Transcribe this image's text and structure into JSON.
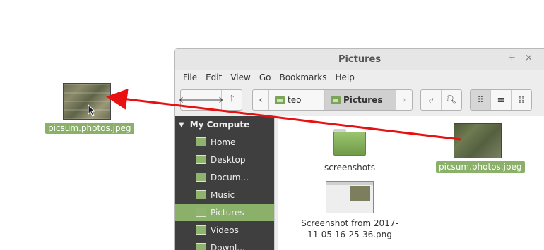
{
  "desktop": {
    "dragged_file": {
      "name": "picsum.photos.jpeg"
    }
  },
  "window": {
    "title": "Pictures",
    "controls": {
      "minimize": "–",
      "maximize": "+",
      "close": "×"
    },
    "menu": [
      "File",
      "Edit",
      "View",
      "Go",
      "Bookmarks",
      "Help"
    ],
    "breadcrumb": [
      "teo",
      "Pictures"
    ],
    "sidebar": {
      "section": "My Compute",
      "items": [
        {
          "label": "Home",
          "selected": false
        },
        {
          "label": "Desktop",
          "selected": false
        },
        {
          "label": "Docum...",
          "selected": false
        },
        {
          "label": "Music",
          "selected": false
        },
        {
          "label": "Pictures",
          "selected": true
        },
        {
          "label": "Videos",
          "selected": false
        },
        {
          "label": "Downl...",
          "selected": false
        }
      ]
    },
    "files": [
      {
        "name": "screenshots",
        "type": "folder"
      },
      {
        "name": "picsum.photos.jpeg",
        "type": "image",
        "selected": true
      },
      {
        "name_line1": "Screenshot from 2017-",
        "name_line2": "11-05 16-25-36.png",
        "type": "image"
      }
    ]
  },
  "colors": {
    "selection": "#8ab06a",
    "sidebar_bg": "#3f3f3f",
    "arrow": "#e81010"
  }
}
